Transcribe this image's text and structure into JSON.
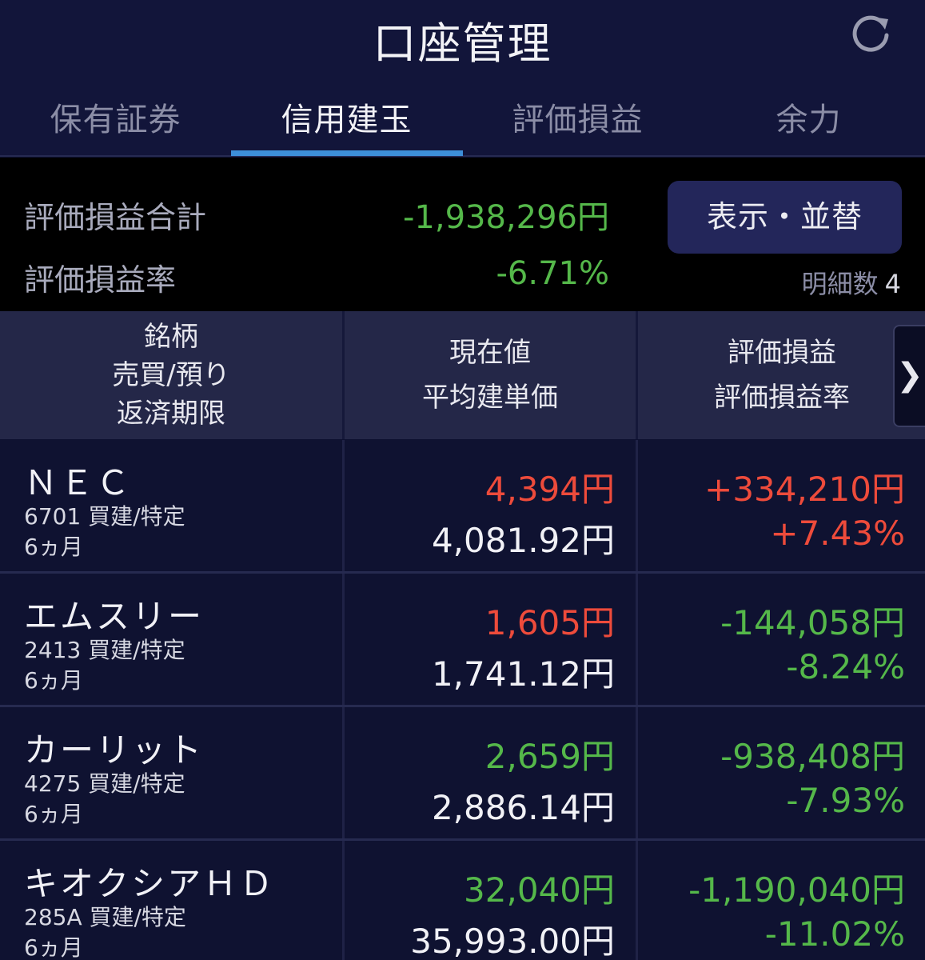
{
  "header": {
    "title": "口座管理",
    "refresh_icon": "refresh-icon"
  },
  "tabs": [
    {
      "label": "保有証券",
      "active": false
    },
    {
      "label": "信用建玉",
      "active": true
    },
    {
      "label": "評価損益",
      "active": false
    },
    {
      "label": "余力",
      "active": false
    }
  ],
  "summary": {
    "total_label": "評価損益合計",
    "total_value": "-1,938,296円",
    "rate_label": "評価損益率",
    "rate_value": "-6.71%",
    "sort_button": "表示・並替",
    "count_label": "明細数",
    "count_value": "4"
  },
  "columns": {
    "col1": [
      "銘柄",
      "売買/預り",
      "返済期限"
    ],
    "col2": [
      "現在値",
      "平均建単価"
    ],
    "col3": [
      "評価損益",
      "評価損益率"
    ],
    "next_icon": "chevron-right-icon"
  },
  "colors": {
    "gain": "#ee4b3b",
    "loss": "#55b84a",
    "accent": "#3d8fd9"
  },
  "rows": [
    {
      "name": "ＮＥＣ",
      "code_trade": "6701 買建/特定",
      "term": "6ヵ月",
      "price": "4,394円",
      "price_color": "red",
      "avg": "4,081.92円",
      "pl": "+334,210円",
      "pl_rate": "+7.43%",
      "pl_color": "red"
    },
    {
      "name": "エムスリー",
      "code_trade": "2413 買建/特定",
      "term": "6ヵ月",
      "price": "1,605円",
      "price_color": "red",
      "avg": "1,741.12円",
      "pl": "-144,058円",
      "pl_rate": "-8.24%",
      "pl_color": "green"
    },
    {
      "name": "カーリット",
      "code_trade": "4275 買建/特定",
      "term": "6ヵ月",
      "price": "2,659円",
      "price_color": "green",
      "avg": "2,886.14円",
      "pl": "-938,408円",
      "pl_rate": "-7.93%",
      "pl_color": "green"
    },
    {
      "name": "キオクシアＨＤ",
      "code_trade": "285A 買建/特定",
      "term": "6ヵ月",
      "price": "32,040円",
      "price_color": "green",
      "avg": "35,993.00円",
      "pl": "-1,190,040円",
      "pl_rate": "-11.02%",
      "pl_color": "green"
    }
  ]
}
